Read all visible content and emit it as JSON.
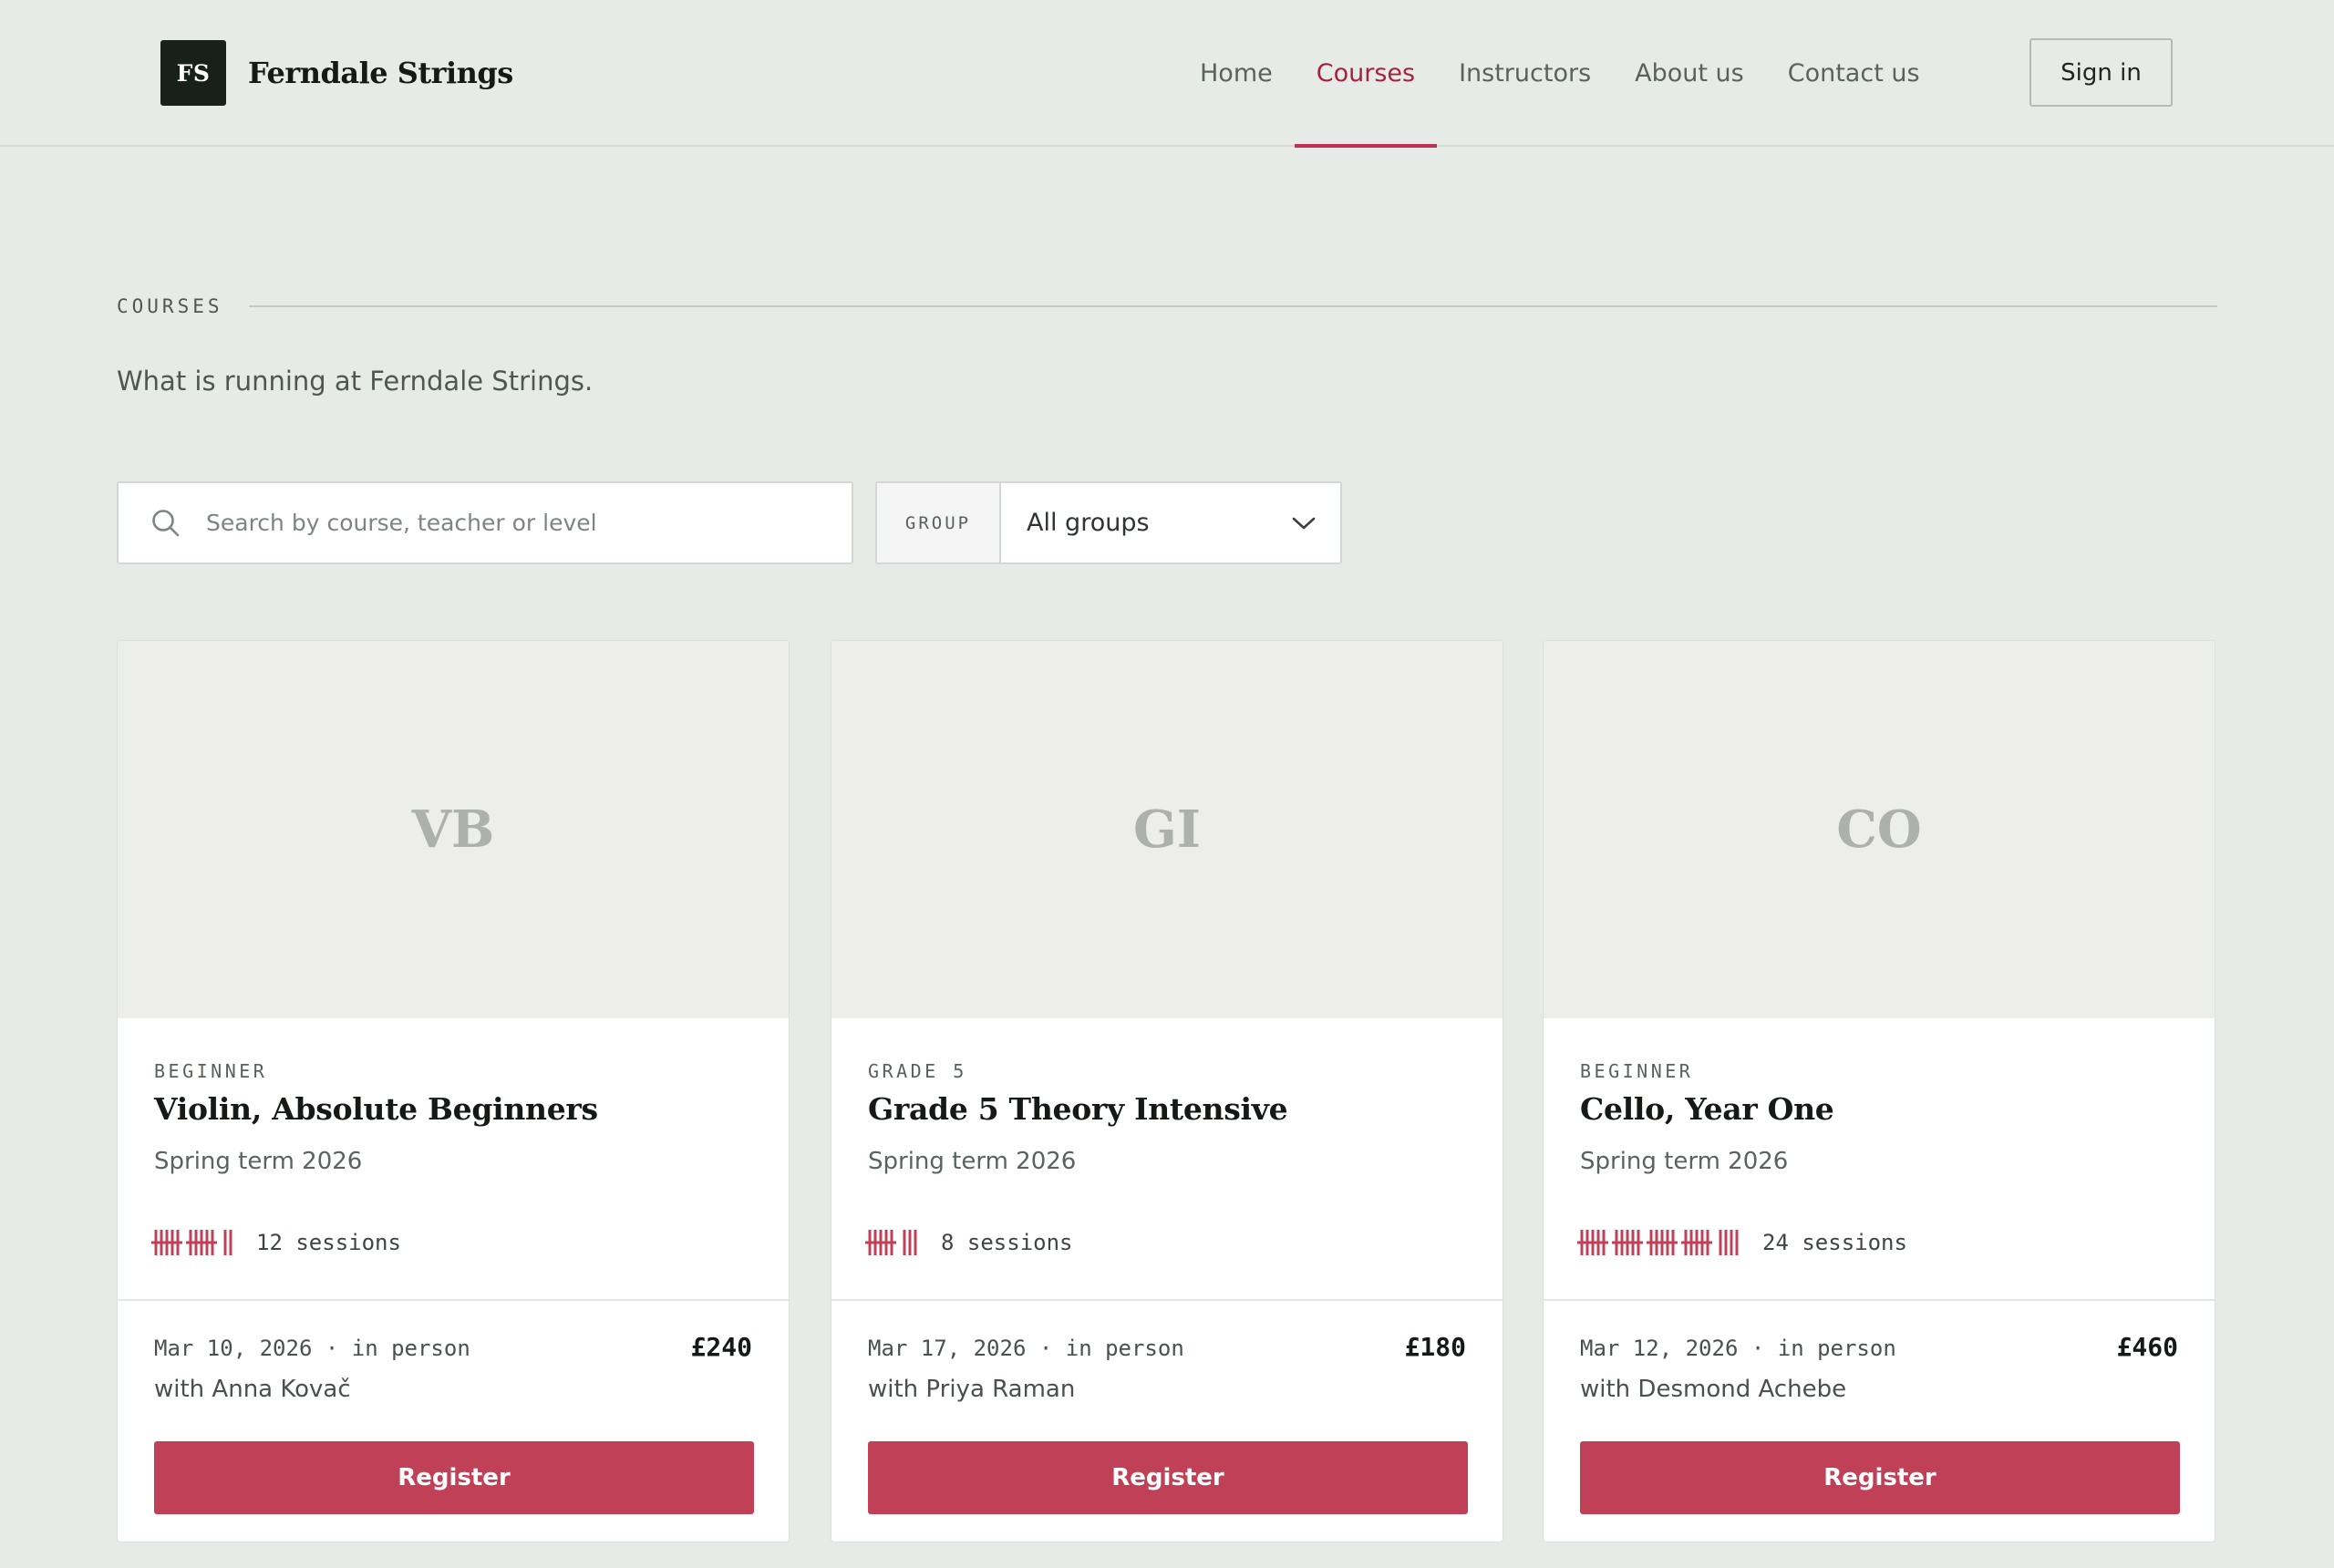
{
  "brand": {
    "mark": "FS",
    "name": "Ferndale Strings"
  },
  "nav": {
    "items": [
      {
        "label": "Home",
        "active": false
      },
      {
        "label": "Courses",
        "active": true
      },
      {
        "label": "Instructors",
        "active": false
      },
      {
        "label": "About us",
        "active": false
      },
      {
        "label": "Contact us",
        "active": false
      }
    ],
    "signin_label": "Sign in"
  },
  "section": {
    "label": "COURSES",
    "subtitle": "What is running at Ferndale Strings."
  },
  "search": {
    "placeholder": "Search by course, teacher or level",
    "value": ""
  },
  "group_filter": {
    "label": "GROUP",
    "selected": "All groups"
  },
  "colors": {
    "accent": "#c04058",
    "nav_active": "#a8213c",
    "background": "#e7ebe8"
  },
  "courses": [
    {
      "initials": "VB",
      "level": "BEGINNER",
      "title": "Violin, Absolute Beginners",
      "term": "Spring term 2026",
      "sessions": 12,
      "sessions_label": "12 sessions",
      "date_mode": "Mar 10, 2026 · in person",
      "price": "£240",
      "teacher": "with Anna Kovač",
      "cta": "Register"
    },
    {
      "initials": "GI",
      "level": "GRADE 5",
      "title": "Grade 5 Theory Intensive",
      "term": "Spring term 2026",
      "sessions": 8,
      "sessions_label": "8 sessions",
      "date_mode": "Mar 17, 2026 · in person",
      "price": "£180",
      "teacher": "with Priya Raman",
      "cta": "Register"
    },
    {
      "initials": "CO",
      "level": "BEGINNER",
      "title": "Cello, Year One",
      "term": "Spring term 2026",
      "sessions": 24,
      "sessions_label": "24 sessions",
      "date_mode": "Mar 12, 2026 · in person",
      "price": "£460",
      "teacher": "with Desmond Achebe",
      "cta": "Register"
    }
  ]
}
